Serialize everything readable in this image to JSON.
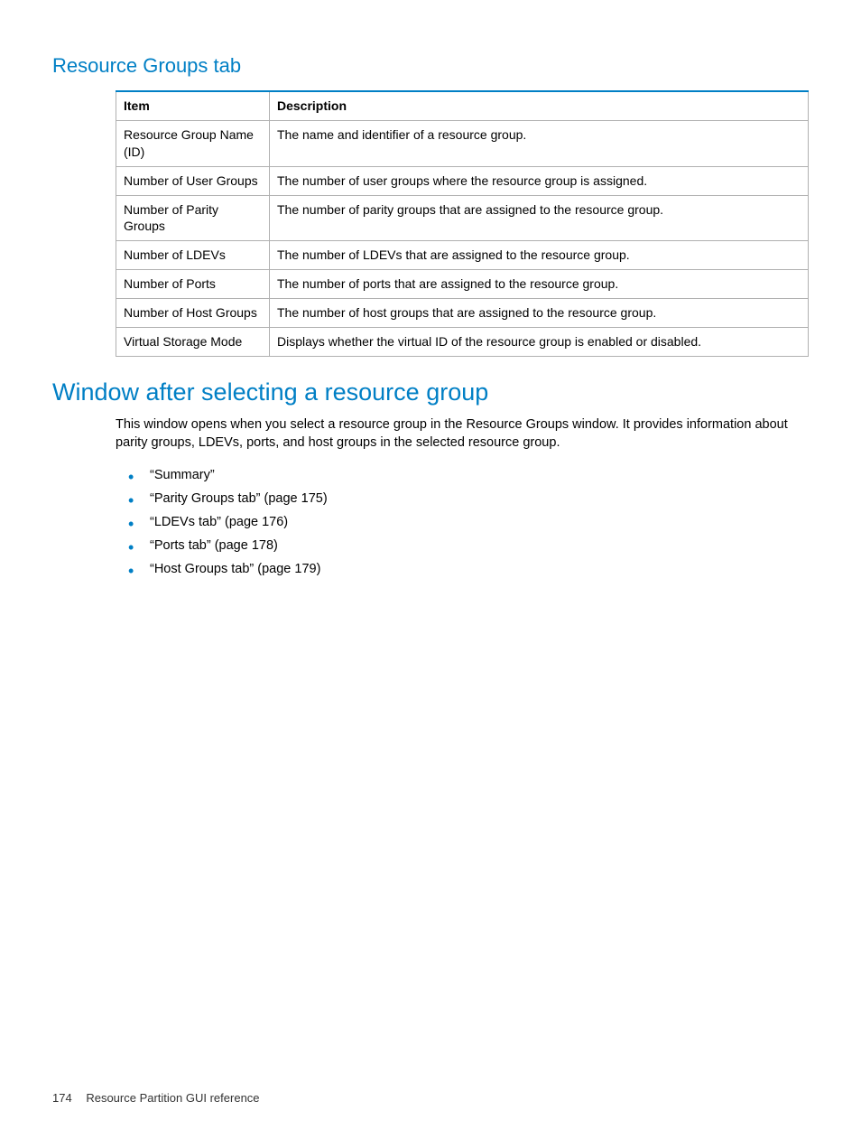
{
  "heading1": "Resource Groups tab",
  "table": {
    "headers": {
      "item": "Item",
      "description": "Description"
    },
    "rows": [
      {
        "item": "Resource Group Name (ID)",
        "description": "The name and identifier of a resource group."
      },
      {
        "item": "Number of User Groups",
        "description": "The number of user groups where the resource group is assigned."
      },
      {
        "item": "Number of Parity Groups",
        "description": "The number of parity groups that are assigned to the resource group."
      },
      {
        "item": "Number of LDEVs",
        "description": "The number of LDEVs that are assigned to the resource group."
      },
      {
        "item": "Number of Ports",
        "description": "The number of ports that are assigned to the resource group."
      },
      {
        "item": "Number of Host Groups",
        "description": "The number of host groups that are assigned to the resource group."
      },
      {
        "item": "Virtual Storage Mode",
        "description": "Displays whether the virtual ID of the resource group is enabled or disabled."
      }
    ]
  },
  "heading2": "Window after selecting a resource group",
  "intro": "This window opens when you select a resource group in the Resource Groups window. It provides information about parity groups, LDEVs, ports, and host groups in the selected resource group.",
  "links": [
    "“Summary”",
    "“Parity Groups tab” (page 175)",
    "“LDEVs tab” (page 176)",
    "“Ports tab” (page 178)",
    "“Host Groups tab” (page 179)"
  ],
  "footer": {
    "page": "174",
    "title": "Resource Partition GUI reference"
  }
}
